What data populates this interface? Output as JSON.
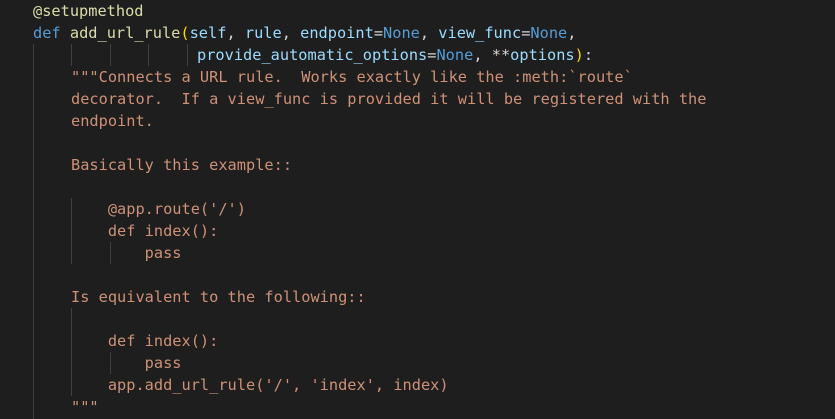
{
  "code": {
    "decorator": "@setupmethod",
    "signature": {
      "def_kw": "def",
      "fn_name": "add_url_rule",
      "open_paren": "(",
      "self": "self",
      "comma1": ", ",
      "rule": "rule",
      "comma2": ", ",
      "endpoint": "endpoint",
      "eq1": "=",
      "none1": "None",
      "comma3": ", ",
      "view_func": "view_func",
      "eq2": "=",
      "none2": "None",
      "comma4": ",",
      "provide_automatic_options": "provide_automatic_options",
      "eq3": "=",
      "none3": "None",
      "comma5": ", ",
      "stars": "**",
      "options": "options",
      "close_paren": ")",
      "colon": ":"
    },
    "docstring": [
      "\"\"\"Connects a URL rule.  Works exactly like the :meth:`route`",
      "decorator.  If a view_func is provided it will be registered with the",
      "endpoint.",
      "",
      "Basically this example::",
      "",
      "    @app.route('/')",
      "    def index():",
      "        pass",
      "",
      "Is equivalent to the following::",
      "",
      "    def index():",
      "        pass",
      "    app.add_url_rule('/', 'index', index)",
      "\"\"\""
    ]
  }
}
